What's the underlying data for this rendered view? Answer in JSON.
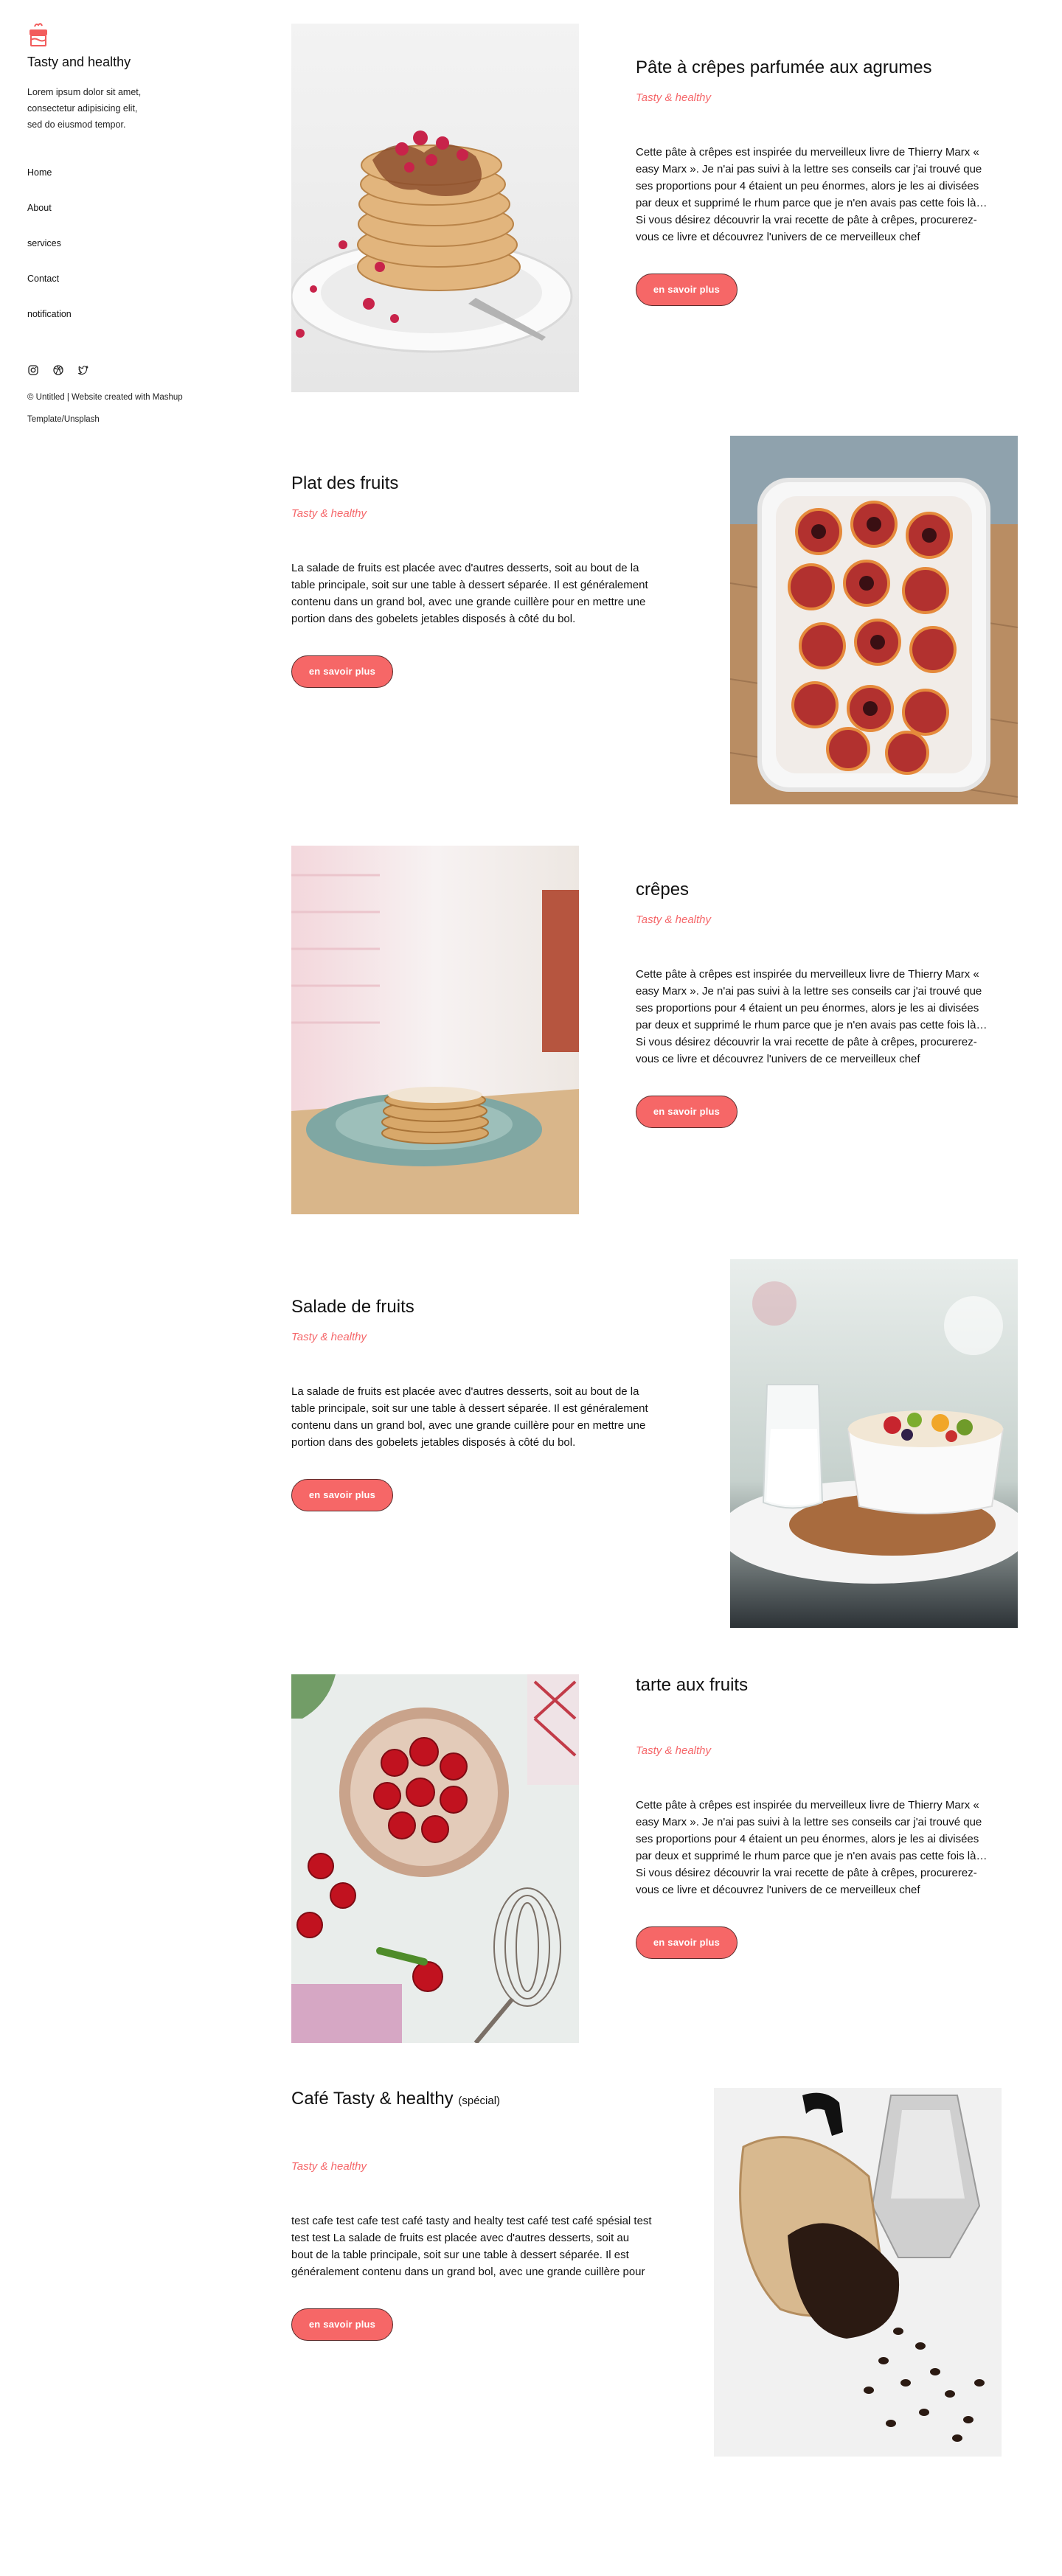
{
  "sidebar": {
    "title": "Tasty and healthy",
    "description": "Lorem ipsum dolor sit amet,\nconsectetur adipisicing elit,\nsed  do eiusmod tempor.",
    "nav": [
      "Home",
      "About",
      "services",
      "Contact",
      "notification"
    ],
    "social_icons": [
      "instagram-icon",
      "dribbble-icon",
      "twitter-icon"
    ],
    "credit": "© Untitled | Website created with Mashup Template/Unsplash"
  },
  "theme": {
    "accent": "#f66767",
    "subtitle_color": "#f5676a"
  },
  "posts": [
    {
      "title": "Pâte à crêpes parfumée aux agrumes",
      "subtitle": "Tasty & healthy",
      "body": "Cette pâte à crêpes est inspirée du merveilleux livre de Thierry Marx « easy Marx ». Je n'ai pas suivi à la lettre ses conseils car j'ai trouvé que ses proportions pour 4 étaient un peu énormes, alors je les ai divisées par deux et supprimé le rhum parce que je n'en avais pas cette fois là…\nSi vous désirez découvrir la vrai recette de pâte à crêpes, procurerez-vous ce livre et découvrez l'univers de ce merveilleux chef",
      "button": "en savoir plus"
    },
    {
      "title": "Plat des fruits",
      "subtitle": "Tasty & healthy",
      "body": "La salade de fruits est placée avec d'autres desserts, soit au bout de la table principale, soit sur une table à dessert séparée. Il est généralement contenu dans un grand bol, avec une grande cuillère pour en mettre une portion dans des gobelets jetables disposés à côté du bol.",
      "button": "en savoir plus"
    },
    {
      "title": "crêpes",
      "subtitle": "Tasty & healthy",
      "body": "Cette pâte à crêpes est inspirée du merveilleux livre de Thierry Marx « easy Marx ». Je n'ai pas suivi à la lettre ses conseils car j'ai trouvé que ses proportions pour 4 étaient un peu énormes, alors je les ai divisées par deux et supprimé le rhum parce que je n'en avais pas cette fois là…\nSi vous désirez découvrir la vrai recette de pâte à crêpes, procurerez-vous ce livre et découvrez l'univers de ce merveilleux chef",
      "button": "en savoir plus"
    },
    {
      "title": "Salade de fruits",
      "subtitle": "Tasty & healthy",
      "body": "La salade de fruits est placée avec d'autres desserts, soit au bout de la table principale, soit sur une table à dessert séparée. Il est généralement contenu dans un grand bol, avec une grande cuillère pour en mettre une portion dans des gobelets jetables disposés à côté du bol.",
      "button": "en savoir plus"
    },
    {
      "title": "tarte aux fruits",
      "subtitle": "Tasty & healthy",
      "body": "Cette pâte à crêpes est inspirée du merveilleux livre de Thierry Marx « easy Marx ». Je n'ai pas suivi à la lettre ses conseils car j'ai trouvé que ses proportions pour 4 étaient un peu énormes, alors je les ai divisées par deux et supprimé le rhum parce que je n'en avais pas cette fois là…\nSi vous désirez découvrir la vrai recette de pâte à crêpes, procurerez-vous ce livre et découvrez l'univers de ce merveilleux chef",
      "button": "en savoir plus"
    },
    {
      "title": "Café Tasty & healthy",
      "title_suffix": "(spécial)",
      "subtitle": "Tasty & healthy",
      "body": "test cafe test cafe test  café tasty and healty test café test café spésial test test test  La salade de fruits est placée avec d'autres desserts, soit au bout de la table principale, soit sur une table à dessert séparée. Il est généralement contenu dans un grand bol, avec une grande cuillère pour",
      "button": "en savoir plus"
    }
  ]
}
